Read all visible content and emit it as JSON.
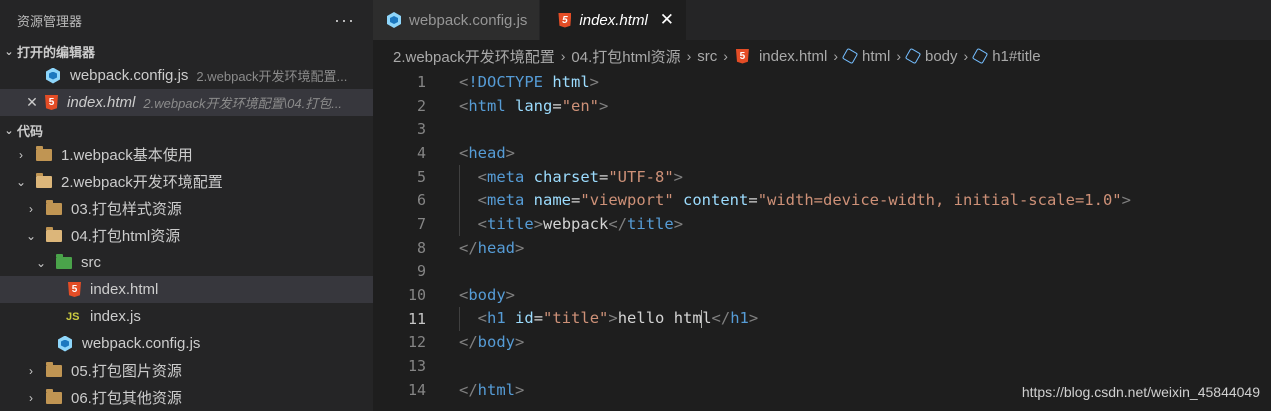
{
  "sidebar": {
    "title": "资源管理器",
    "more": "···",
    "open_editors": {
      "title": "打开的编辑器",
      "items": [
        {
          "name": "webpack.config.js",
          "hint": "2.webpack开发环境配置..."
        },
        {
          "name": "index.html",
          "hint": "2.webpack开发环境配置\\04.打包..."
        }
      ]
    },
    "workspace": {
      "title": "代码",
      "items": [
        "1.webpack基本使用",
        "2.webpack开发环境配置",
        "03.打包样式资源",
        "04.打包html资源",
        "src",
        "index.html",
        "index.js",
        "webpack.config.js",
        "05.打包图片资源",
        "06.打包其他资源"
      ]
    }
  },
  "tabs": [
    {
      "label": "webpack.config.js"
    },
    {
      "label": "index.html",
      "close": "✕"
    }
  ],
  "breadcrumb": [
    "2.webpack开发环境配置",
    "04.打包html资源",
    "src",
    "index.html",
    "html",
    "body",
    "h1#title"
  ],
  "code": {
    "line_numbers": [
      "1",
      "2",
      "3",
      "4",
      "5",
      "6",
      "7",
      "8",
      "9",
      "10",
      "11",
      "12",
      "13",
      "14"
    ],
    "l1": {
      "open": "<",
      "kw": "!DOCTYPE",
      "sp": " ",
      "v": "html",
      "close": ">"
    },
    "l2": {
      "lt": "<",
      "tag": "html",
      "attr": " lang",
      "eq": "=",
      "val": "\"en\"",
      "gt": ">"
    },
    "l4": {
      "lt": "<",
      "tag": "head",
      "gt": ">"
    },
    "l5": {
      "lt": "<",
      "tag": "meta",
      "attr": " charset",
      "eq": "=",
      "val": "\"UTF-8\"",
      "gt": ">"
    },
    "l6": {
      "lt": "<",
      "tag": "meta",
      "attr1": " name",
      "eq": "=",
      "val1": "\"viewport\"",
      "attr2": " content",
      "val2": "\"width=device-width, initial-scale=1.0\"",
      "gt": ">"
    },
    "l7": {
      "lt": "<",
      "tag": "title",
      "gt": ">",
      "text": "webpack",
      "lt2": "</",
      "tag2": "title",
      "gt2": ">"
    },
    "l8": {
      "lt": "</",
      "tag": "head",
      "gt": ">"
    },
    "l10": {
      "lt": "<",
      "tag": "body",
      "gt": ">"
    },
    "l11": {
      "lt": "<",
      "tag": "h1",
      "attr": " id",
      "eq": "=",
      "val": "\"title\"",
      "gt": ">",
      "text_a": "hello htm",
      "text_b": "l",
      "lt2": "</",
      "tag2": "h1",
      "gt2": ">"
    },
    "l12": {
      "lt": "</",
      "tag": "body",
      "gt": ">"
    },
    "l14": {
      "lt": "</",
      "tag": "html",
      "gt": ">"
    },
    "current_line": 11
  },
  "watermark": "https://blog.csdn.net/weixin_45844049",
  "colors": {
    "tag": "#569cd6",
    "attr": "#9cdcfe",
    "string": "#ce9178",
    "bracket": "#808080",
    "html_icon": "#e44d26",
    "webpack_icon": "#8ed6fb"
  }
}
